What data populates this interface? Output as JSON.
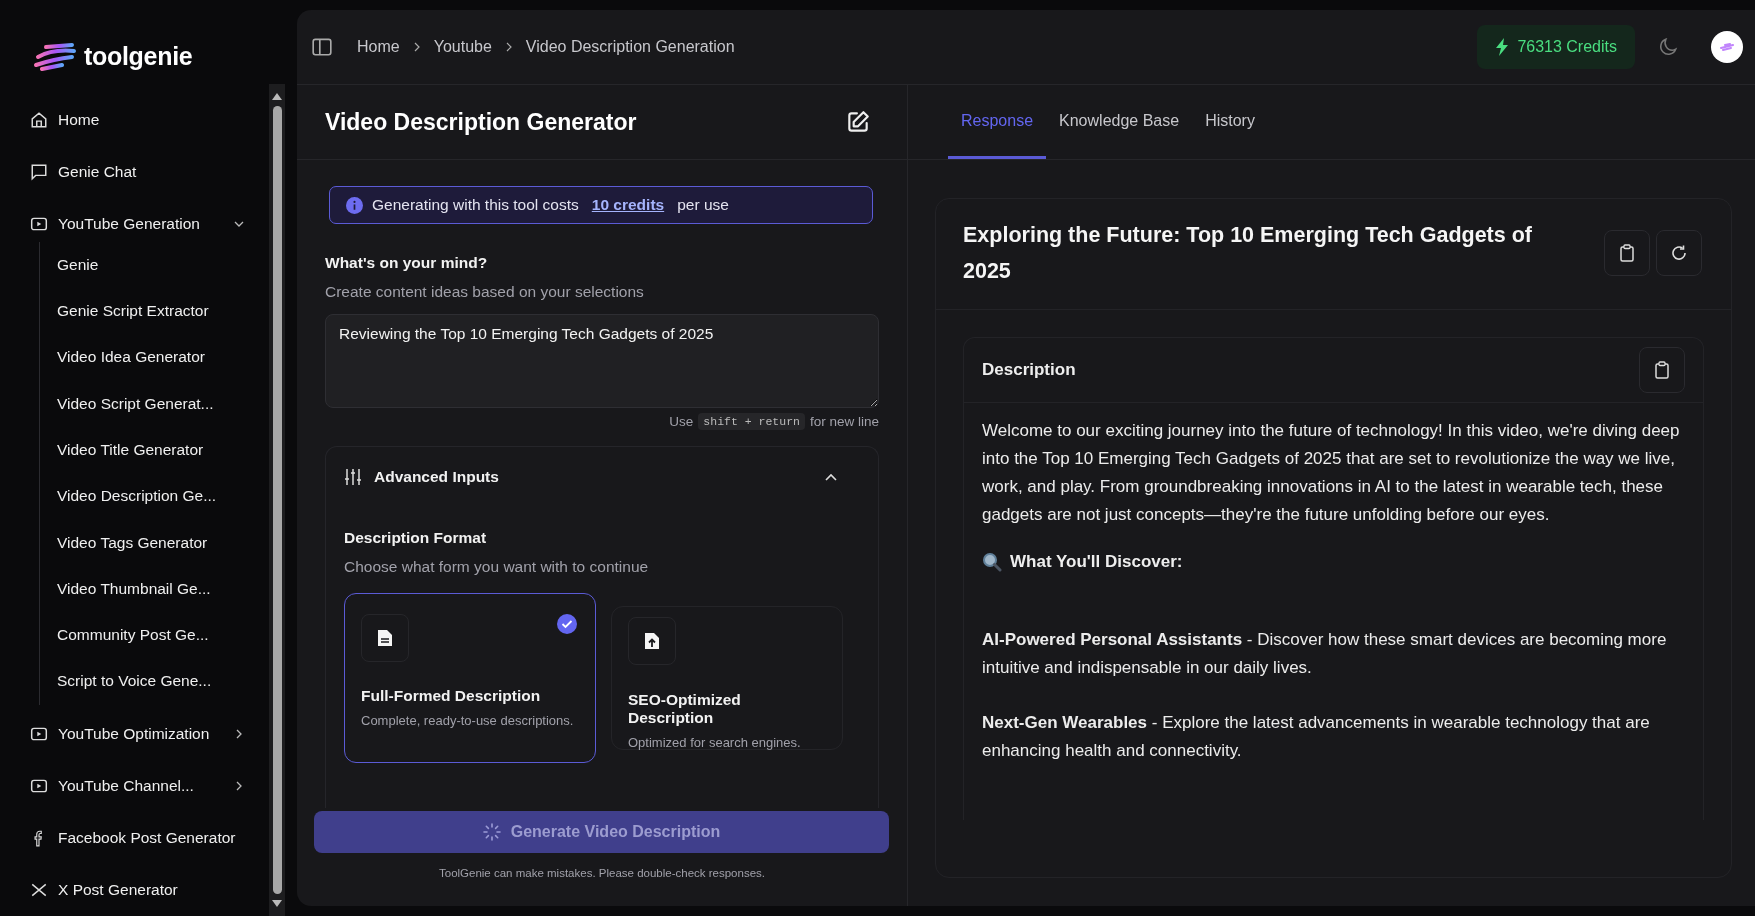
{
  "sidebar": {
    "logo": "toolgenie",
    "items": [
      {
        "kind": "home",
        "label": "Home"
      },
      {
        "kind": "chat",
        "label": "Genie Chat"
      },
      {
        "kind": "group",
        "label": "YouTube Generation",
        "expanded": true,
        "children": [
          {
            "label": "Genie"
          },
          {
            "label": "Genie Script Extractor"
          },
          {
            "label": "Video Idea Generator"
          },
          {
            "label": "Video Script Generat..."
          },
          {
            "label": "Video Title Generator"
          },
          {
            "label": "Video Description Ge..."
          },
          {
            "label": "Video Tags Generator"
          },
          {
            "label": "Video Thumbnail Ge..."
          },
          {
            "label": "Community Post Ge..."
          },
          {
            "label": "Script to Voice Gene..."
          }
        ]
      },
      {
        "kind": "group",
        "label": "YouTube Optimization",
        "expanded": false
      },
      {
        "kind": "group",
        "label": "YouTube Channel...",
        "expanded": false
      },
      {
        "kind": "facebook",
        "label": "Facebook Post Generator"
      },
      {
        "kind": "x",
        "label": "X Post Generator"
      }
    ]
  },
  "header": {
    "breadcrumbs": [
      "Home",
      "Youtube",
      "Video Description Generation"
    ],
    "credits": "76313 Credits"
  },
  "form": {
    "title": "Video Description Generator",
    "info": {
      "before": "Generating with this tool costs",
      "link": "10 credits",
      "after": "per use"
    },
    "prompt": {
      "label": "What's on your mind?",
      "hint": "Create content ideas based on your selections",
      "value": "Reviewing the Top 10 Emerging Tech Gadgets of 2025"
    },
    "shortcut": {
      "before": "Use",
      "key": "shift + return",
      "after": "for new line"
    },
    "advanced": {
      "title": "Advanced Inputs",
      "expanded": true,
      "format_label": "Description Format",
      "format_hint": "Choose what form you want with to continue",
      "options": [
        {
          "kind": "full",
          "title": "Full-Formed Description",
          "desc": "Complete, ready-to-use descriptions.",
          "selected": true
        },
        {
          "kind": "seo",
          "title": "SEO-Optimized Description",
          "desc": "Optimized for search engines.",
          "selected": false
        }
      ]
    },
    "generate_button": {
      "label": "Generate Video Description",
      "loading": true
    },
    "disclaimer": "ToolGenie can make mistakes. Please double-check responses."
  },
  "response": {
    "tabs": [
      {
        "label": "Response",
        "selected": true
      },
      {
        "label": "Knowledge Base",
        "selected": false
      },
      {
        "label": "History",
        "selected": false
      }
    ],
    "title": "Exploring the Future: Top 10 Emerging Tech Gadgets of 2025",
    "section_title": "Description",
    "blocks": [
      {
        "kind": "text",
        "text": "Welcome to our exciting journey into the future of technology! In this video, we're diving deep into the Top 10 Emerging Tech Gadgets of 2025 that are set to revolutionize the way we live, work, and play. From groundbreaking innovations in AI to the latest in wearable tech, these gadgets are not just concepts—they're the future unfolding before our eyes."
      },
      {
        "kind": "heading",
        "text": "What You'll Discover:"
      },
      {
        "kind": "text",
        "text": "**AI-Powered Personal Assistants** - Discover how these smart devices are becoming more intuitive and indispensable in our daily lives."
      },
      {
        "kind": "text",
        "text": "**Next-Gen Wearables** - Explore the latest advancements in wearable technology that are enhancing health and connectivity."
      }
    ]
  }
}
